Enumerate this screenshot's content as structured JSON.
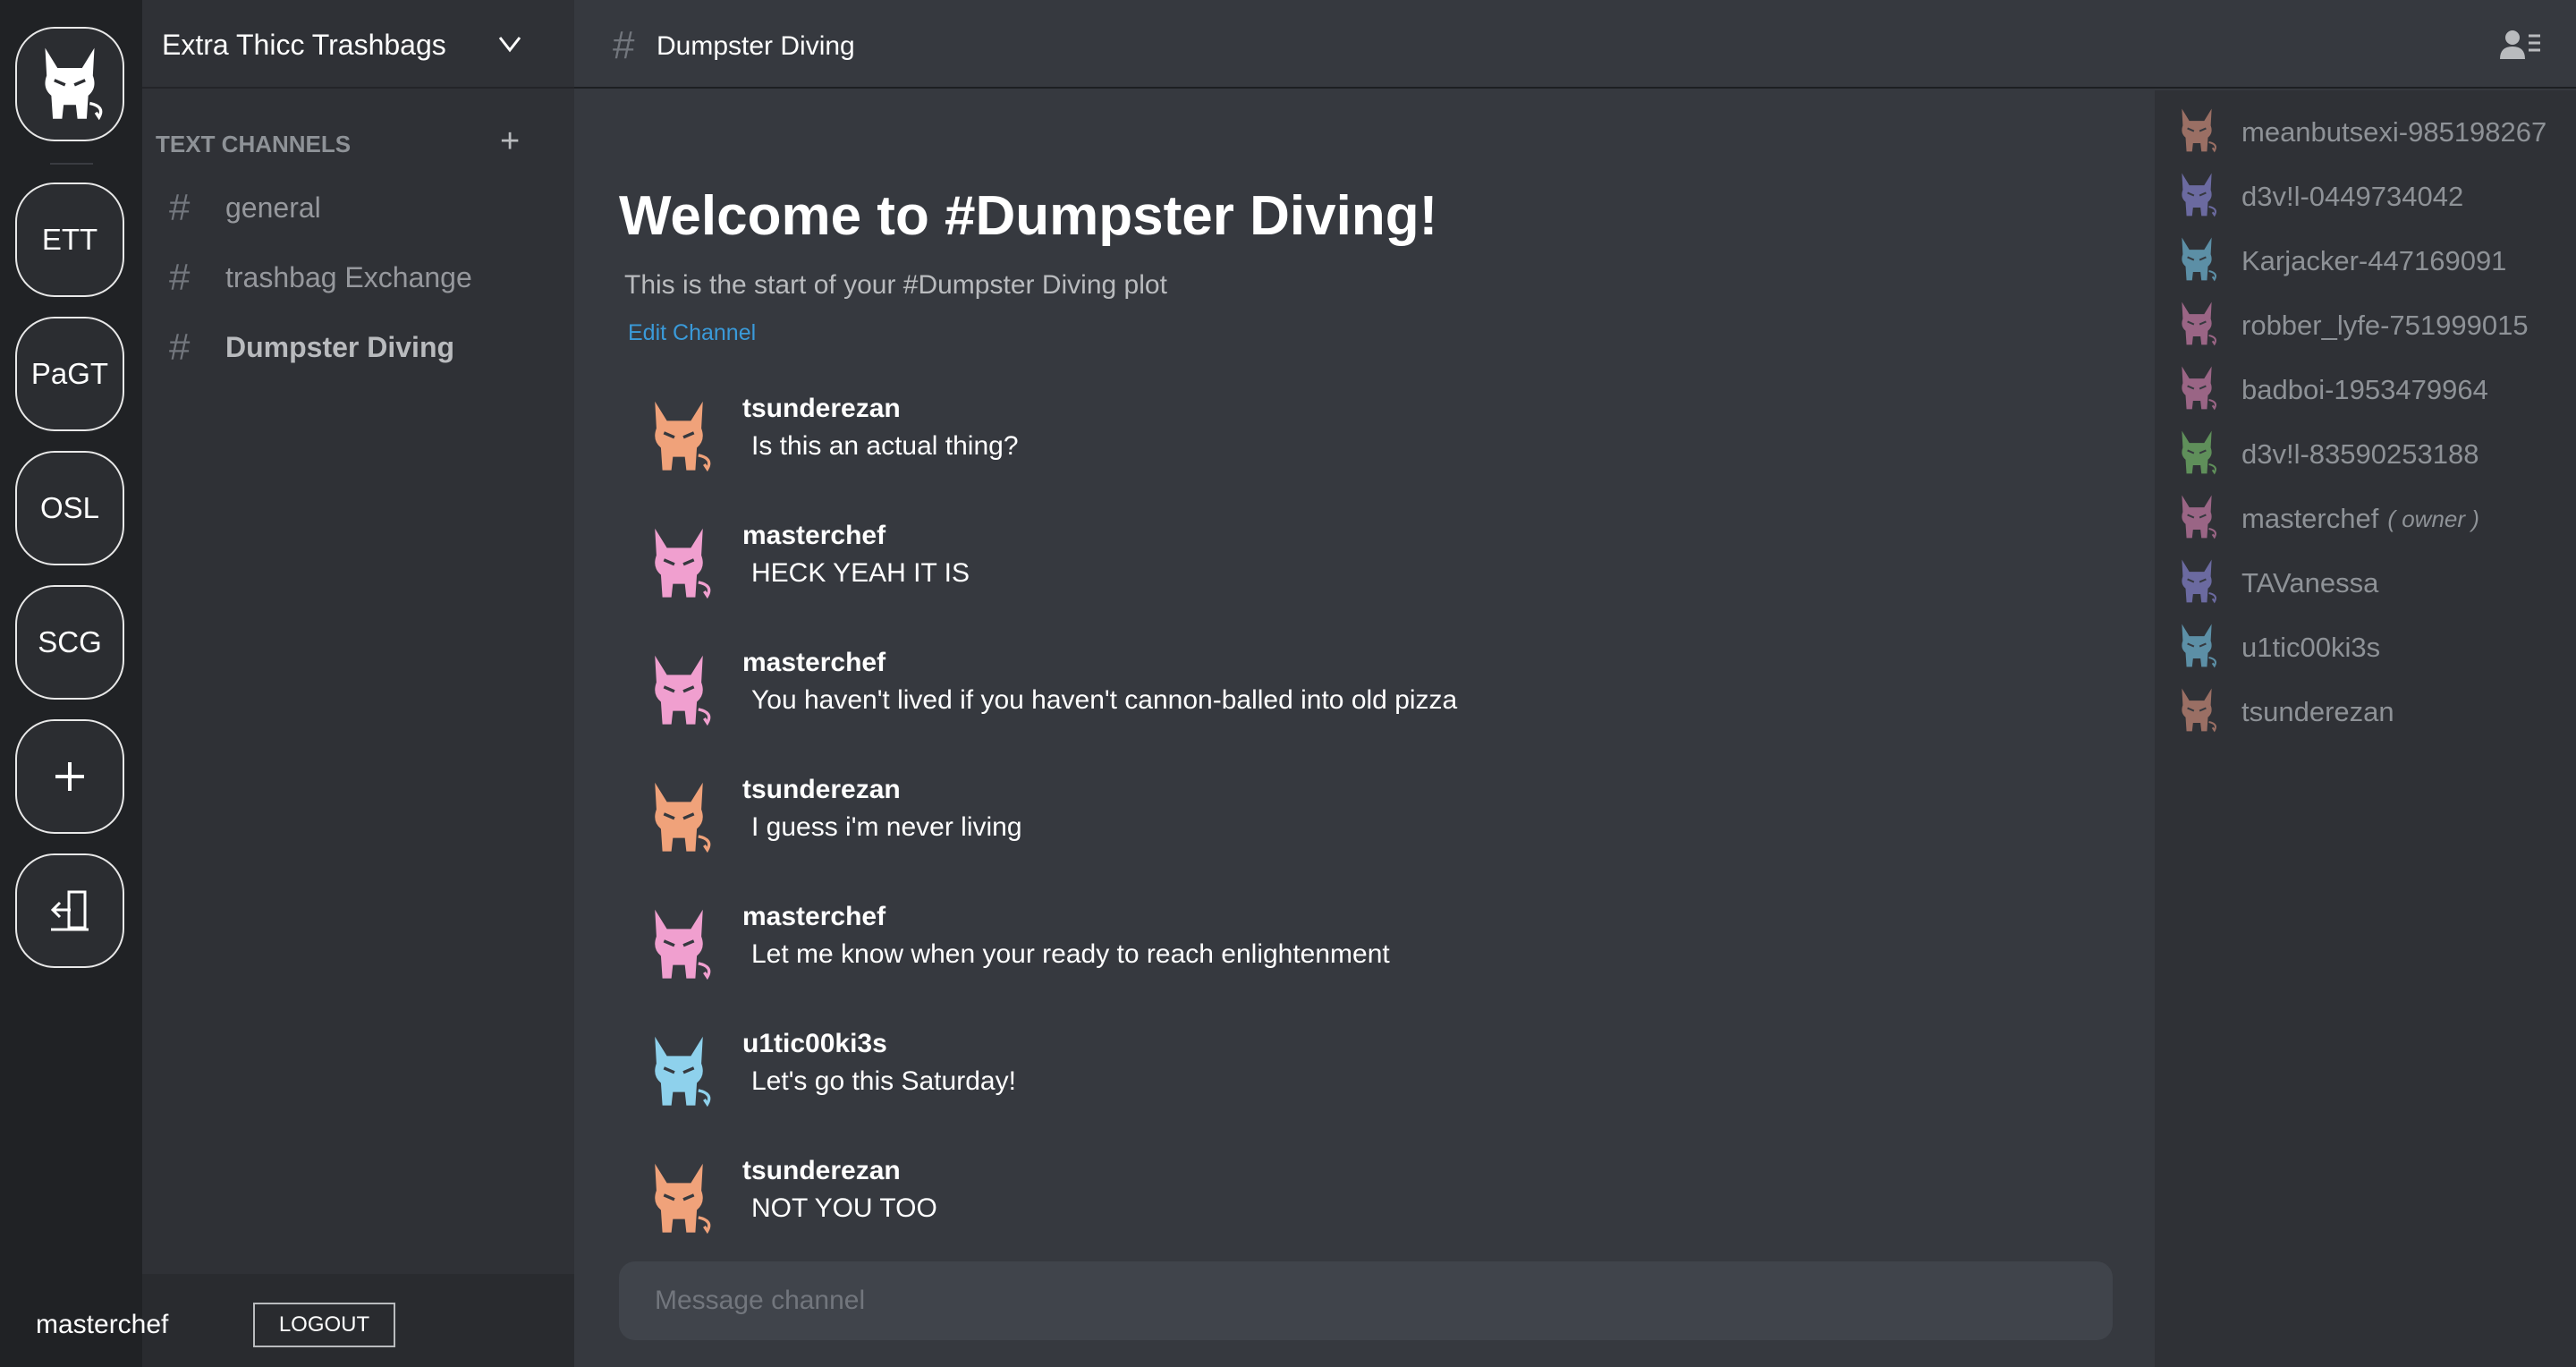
{
  "servers": [
    {
      "label": "ETT"
    },
    {
      "label": "PaGT"
    },
    {
      "label": "OSL"
    },
    {
      "label": "SCG"
    }
  ],
  "rail": {
    "add_icon": "plus-icon",
    "exit_icon": "exit-door-icon",
    "logo_icon": "devil-cat-logo"
  },
  "sidebar": {
    "server_name": "Extra Thicc Trashbags",
    "category": "TEXT CHANNELS",
    "add_channel": "+",
    "channels": [
      {
        "name": "general"
      },
      {
        "name": "trashbag Exchange"
      },
      {
        "name": "Dumpster Diving"
      }
    ],
    "active_channel": "Dumpster Diving"
  },
  "user_panel": {
    "username": "masterchef",
    "logout_label": "LOGOUT"
  },
  "header": {
    "hash": "#",
    "channel_title": "Dumpster Diving"
  },
  "welcome": {
    "title": "Welcome to #Dumpster Diving!",
    "subtitle": "This is the start of your #Dumpster Diving plot",
    "edit_link": "Edit Channel"
  },
  "messages": [
    {
      "author": "tsunderezan",
      "text": "Is this an actual thing?",
      "avatar_color": "#f0a27a"
    },
    {
      "author": "masterchef",
      "text": "HECK YEAH IT IS",
      "avatar_color": "#f09fcf"
    },
    {
      "author": "masterchef",
      "text": "You haven't lived if you haven't cannon-balled into old pizza",
      "avatar_color": "#f09fcf"
    },
    {
      "author": "tsunderezan",
      "text": "I guess i'm never living",
      "avatar_color": "#f0a27a"
    },
    {
      "author": "masterchef",
      "text": "Let me know when your ready to reach enlightenment",
      "avatar_color": "#f09fcf"
    },
    {
      "author": "u1tic00ki3s",
      "text": "Let's go this Saturday!",
      "avatar_color": "#8ed1ec"
    },
    {
      "author": "tsunderezan",
      "text": "NOT YOU TOO",
      "avatar_color": "#f0a27a"
    }
  ],
  "composer": {
    "placeholder": "Message channel"
  },
  "members": [
    {
      "name": "meanbutsexi-985198267",
      "color": "#9a6f64"
    },
    {
      "name": "d3v!l-0449734042",
      "color": "#6b6aa0"
    },
    {
      "name": "Karjacker-447169091",
      "color": "#5c8fa6"
    },
    {
      "name": "robber_lyfe-751999015",
      "color": "#9a6585"
    },
    {
      "name": "badboi-1953479964",
      "color": "#9a6585"
    },
    {
      "name": "d3v!l-83590253188",
      "color": "#5f8f5a"
    },
    {
      "name": "masterchef",
      "color": "#9a6585",
      "tag": "( owner )"
    },
    {
      "name": "TAVanessa",
      "color": "#6b6aa0"
    },
    {
      "name": "u1tic00ki3s",
      "color": "#5c8fa6"
    },
    {
      "name": "tsunderezan",
      "color": "#9a6f64"
    }
  ]
}
